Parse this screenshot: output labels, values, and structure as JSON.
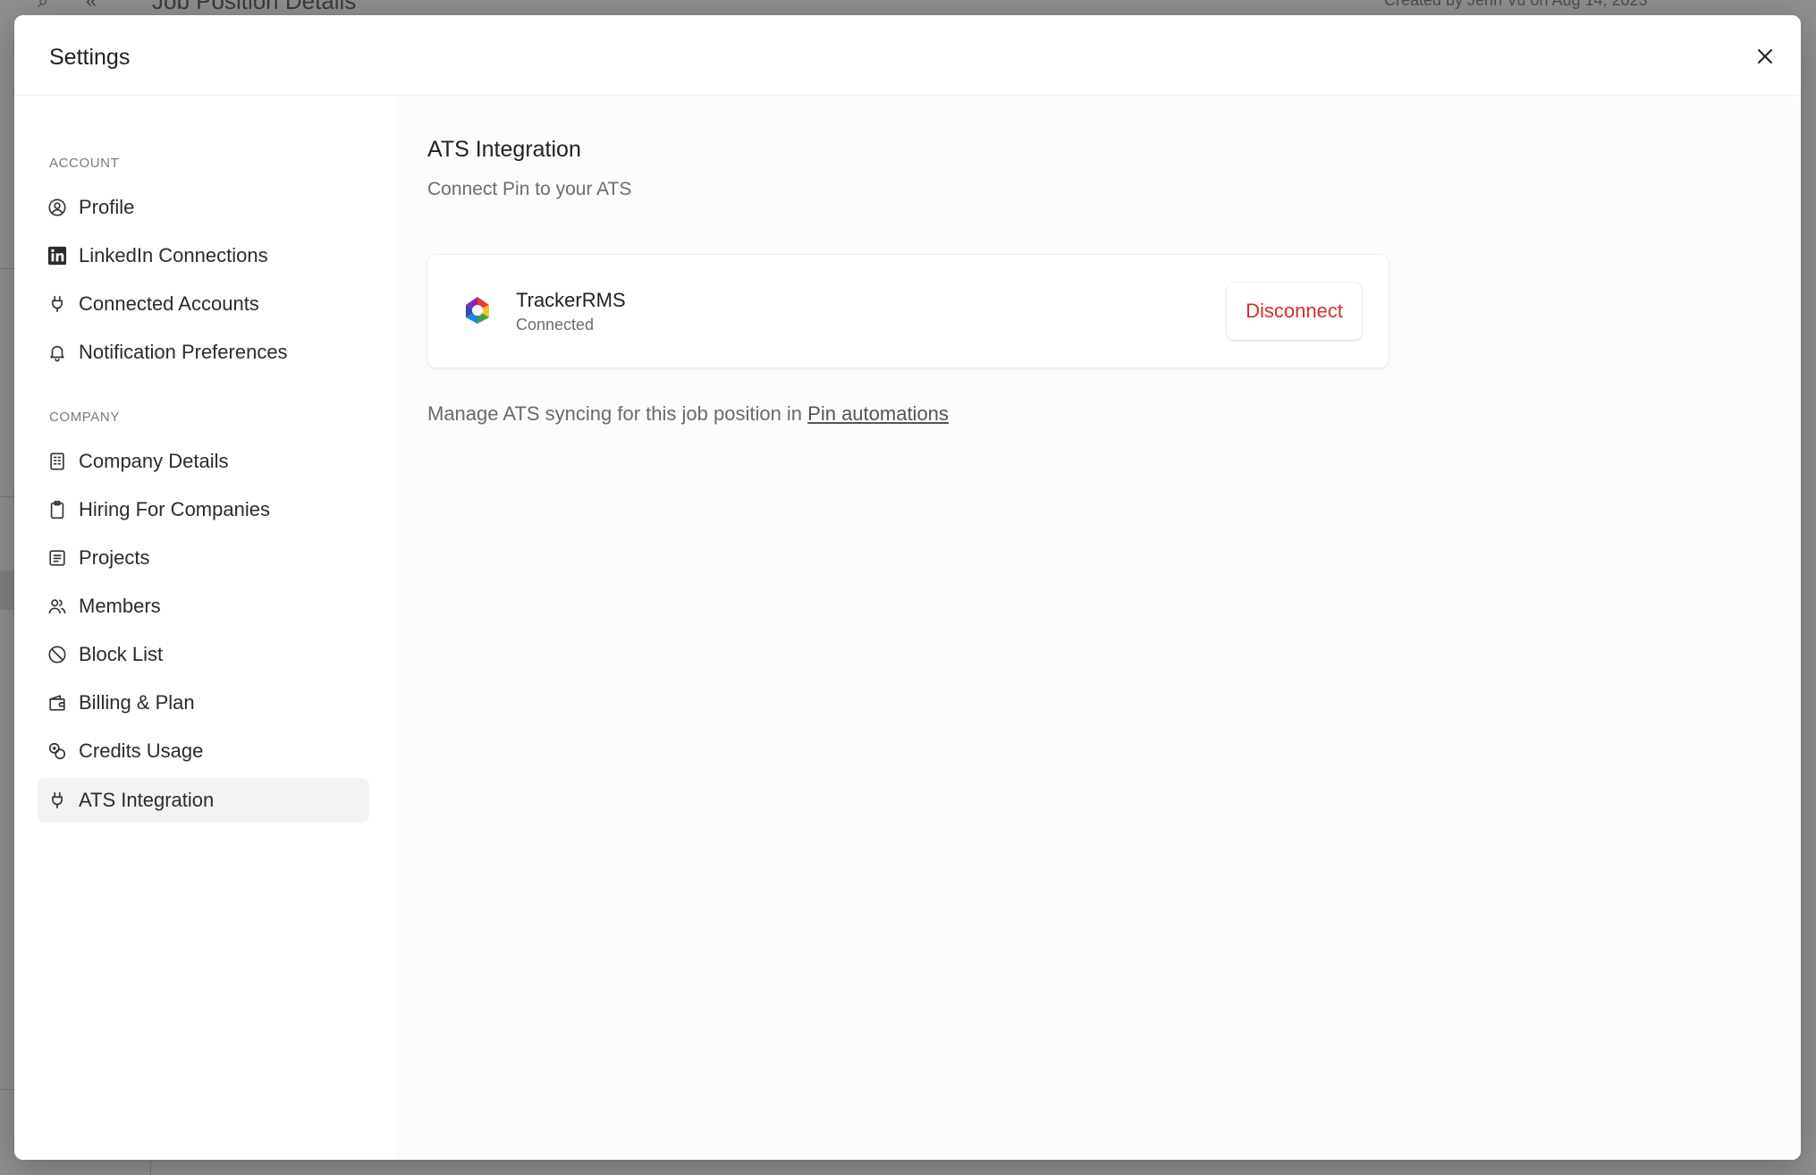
{
  "background": {
    "title": "Job Position Details",
    "meta": "Created by Jenn Vu on Aug 14, 2023"
  },
  "modal": {
    "title": "Settings"
  },
  "sidebar": {
    "account_label": "ACCOUNT",
    "account_items": [
      {
        "label": "Profile",
        "icon": "user-circle-icon"
      },
      {
        "label": "LinkedIn Connections",
        "icon": "linkedin-icon"
      },
      {
        "label": "Connected Accounts",
        "icon": "plug-icon"
      },
      {
        "label": "Notification Preferences",
        "icon": "bell-icon"
      }
    ],
    "company_label": "COMPANY",
    "company_items": [
      {
        "label": "Company Details",
        "icon": "building-icon"
      },
      {
        "label": "Hiring For Companies",
        "icon": "clipboard-icon"
      },
      {
        "label": "Projects",
        "icon": "list-icon"
      },
      {
        "label": "Members",
        "icon": "users-icon"
      },
      {
        "label": "Block List",
        "icon": "ban-icon"
      },
      {
        "label": "Billing & Plan",
        "icon": "wallet-icon"
      },
      {
        "label": "Credits Usage",
        "icon": "coins-icon"
      },
      {
        "label": "ATS Integration",
        "icon": "plug-icon",
        "active": true
      }
    ]
  },
  "main": {
    "title": "ATS Integration",
    "subtitle": "Connect Pin to your ATS",
    "integration": {
      "name": "TrackerRMS",
      "status": "Connected",
      "action_label": "Disconnect"
    },
    "manage_text": "Manage ATS syncing for this job position in ",
    "manage_link": "Pin automations"
  },
  "colors": {
    "danger": "#d0312d",
    "active_bg": "#f3f3f3"
  }
}
